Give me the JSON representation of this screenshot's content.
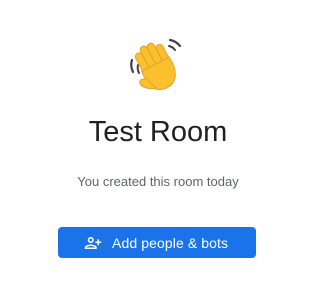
{
  "room": {
    "title": "Test Room",
    "subtitle": "You created this room today"
  },
  "illustration": {
    "icon": "waving-hand-icon"
  },
  "actions": {
    "add_people_label": "Add people & bots",
    "add_people_icon": "person-add-icon"
  },
  "colors": {
    "primary": "#1a73e8",
    "title_text": "#202124",
    "subtitle_text": "#5f6368",
    "emoji_yellow": "#fbc02d"
  }
}
